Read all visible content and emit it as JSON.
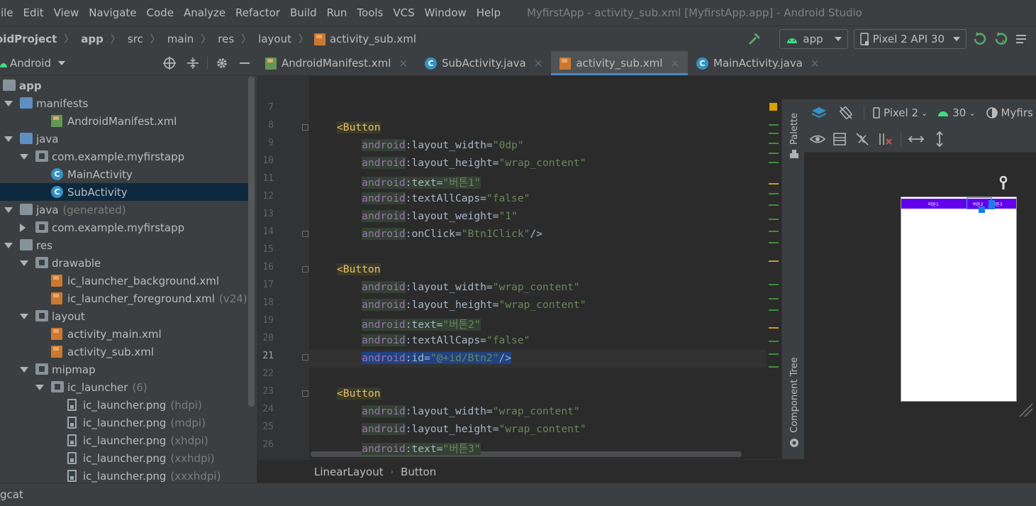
{
  "menu": [
    "ile",
    "Edit",
    "View",
    "Navigate",
    "Code",
    "Analyze",
    "Refactor",
    "Build",
    "Run",
    "Tools",
    "VCS",
    "Window",
    "Help"
  ],
  "window_title": "MyfirstApp - activity_sub.xml [MyfirstApp.app] - Android Studio",
  "breadcrumbs": [
    "oidProject",
    "app",
    "src",
    "main",
    "res",
    "layout",
    "activity_sub.xml"
  ],
  "run_config": "app",
  "device": "Pixel 2 API 30",
  "project_view": "Android",
  "tree": [
    {
      "label": "app",
      "indent": 0,
      "icon": "app",
      "bold": true
    },
    {
      "label": "manifests",
      "indent": 1,
      "arrow": "down",
      "icon": "folder-blue"
    },
    {
      "label": "AndroidManifest.xml",
      "indent": 3,
      "icon": "manifest"
    },
    {
      "label": "java",
      "indent": 1,
      "arrow": "down",
      "icon": "folder-blue"
    },
    {
      "label": "com.example.myfirstapp",
      "indent": 2,
      "arrow": "down",
      "icon": "package"
    },
    {
      "label": "MainActivity",
      "indent": 3,
      "icon": "class"
    },
    {
      "label": "SubActivity",
      "indent": 3,
      "icon": "class",
      "selected": true
    },
    {
      "label": "java",
      "suffix": "(generated)",
      "indent": 1,
      "arrow": "down",
      "icon": "folder-gen"
    },
    {
      "label": "com.example.myfirstapp",
      "indent": 2,
      "arrow": "right",
      "icon": "package"
    },
    {
      "label": "res",
      "indent": 1,
      "arrow": "down",
      "icon": "folder-res"
    },
    {
      "label": "drawable",
      "indent": 2,
      "arrow": "down",
      "icon": "package"
    },
    {
      "label": "ic_launcher_background.xml",
      "indent": 3,
      "icon": "xml"
    },
    {
      "label": "ic_launcher_foreground.xml",
      "suffix": "(v24)",
      "indent": 3,
      "icon": "xml"
    },
    {
      "label": "layout",
      "indent": 2,
      "arrow": "down",
      "icon": "package"
    },
    {
      "label": "activity_main.xml",
      "indent": 3,
      "icon": "xml"
    },
    {
      "label": "activity_sub.xml",
      "indent": 3,
      "icon": "xml"
    },
    {
      "label": "mipmap",
      "indent": 2,
      "arrow": "down",
      "icon": "package"
    },
    {
      "label": "ic_launcher",
      "suffix": "(6)",
      "indent": 3,
      "arrow": "down",
      "icon": "package"
    },
    {
      "label": "ic_launcher.png",
      "suffix": "(hdpi)",
      "indent": 4,
      "icon": "png"
    },
    {
      "label": "ic_launcher.png",
      "suffix": "(mdpi)",
      "indent": 4,
      "icon": "png"
    },
    {
      "label": "ic_launcher.png",
      "suffix": "(xhdpi)",
      "indent": 4,
      "icon": "png"
    },
    {
      "label": "ic_launcher.png",
      "suffix": "(xxhdpi)",
      "indent": 4,
      "icon": "png"
    },
    {
      "label": "ic_launcher.png",
      "suffix": "(xxxhdpi)",
      "indent": 4,
      "icon": "png"
    }
  ],
  "tabs": [
    {
      "label": "AndroidManifest.xml",
      "icon": "manifest"
    },
    {
      "label": "SubActivity.java",
      "icon": "class"
    },
    {
      "label": "activity_sub.xml",
      "icon": "xml",
      "active": true
    },
    {
      "label": "MainActivity.java",
      "icon": "class"
    }
  ],
  "line_numbers": [
    "7",
    "8",
    "9",
    "10",
    "11",
    "12",
    "13",
    "14",
    "15",
    "16",
    "17",
    "18",
    "19",
    "20",
    "21",
    "22",
    "23",
    "24",
    "25",
    "26"
  ],
  "current_line": "21",
  "editor_breadcrumb": [
    "LinearLayout",
    "Button"
  ],
  "palette_label": "Palette",
  "component_tree_label": "Component Tree",
  "design_toolbar": {
    "device": "Pixel 2",
    "api": "30",
    "theme": "Myfirs"
  },
  "preview_buttons": [
    "버튼1",
    "버튼2",
    "버튼3"
  ],
  "bottom_tool": "gcat",
  "colors": {
    "accent": "#4a88c7",
    "purple_bar": "#6200ee",
    "selection": "#214283"
  }
}
